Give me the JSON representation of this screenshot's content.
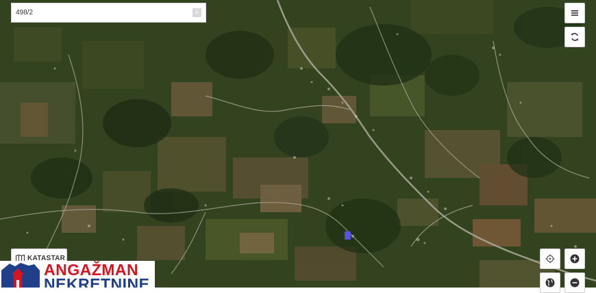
{
  "search": {
    "value": "498/2",
    "clear_label": "×"
  },
  "controls": {
    "menu_icon": "hamburger-menu-icon",
    "refresh_icon": "refresh-icon",
    "locate_icon": "crosshair-icon",
    "zoom_in_icon": "plus-icon",
    "zoom_out_icon": "minus-icon",
    "globe_icon": "globe-icon"
  },
  "layer_button": {
    "label": "KATASTAR",
    "icon": "map-layers-icon"
  },
  "logo": {
    "line1": "ANGAŽMAN",
    "line2": "NEKRETNINE"
  },
  "marker": {
    "color": "#5b52e8"
  },
  "colors": {
    "logo_red": "#d7141f",
    "logo_blue": "#1f3f8a"
  }
}
